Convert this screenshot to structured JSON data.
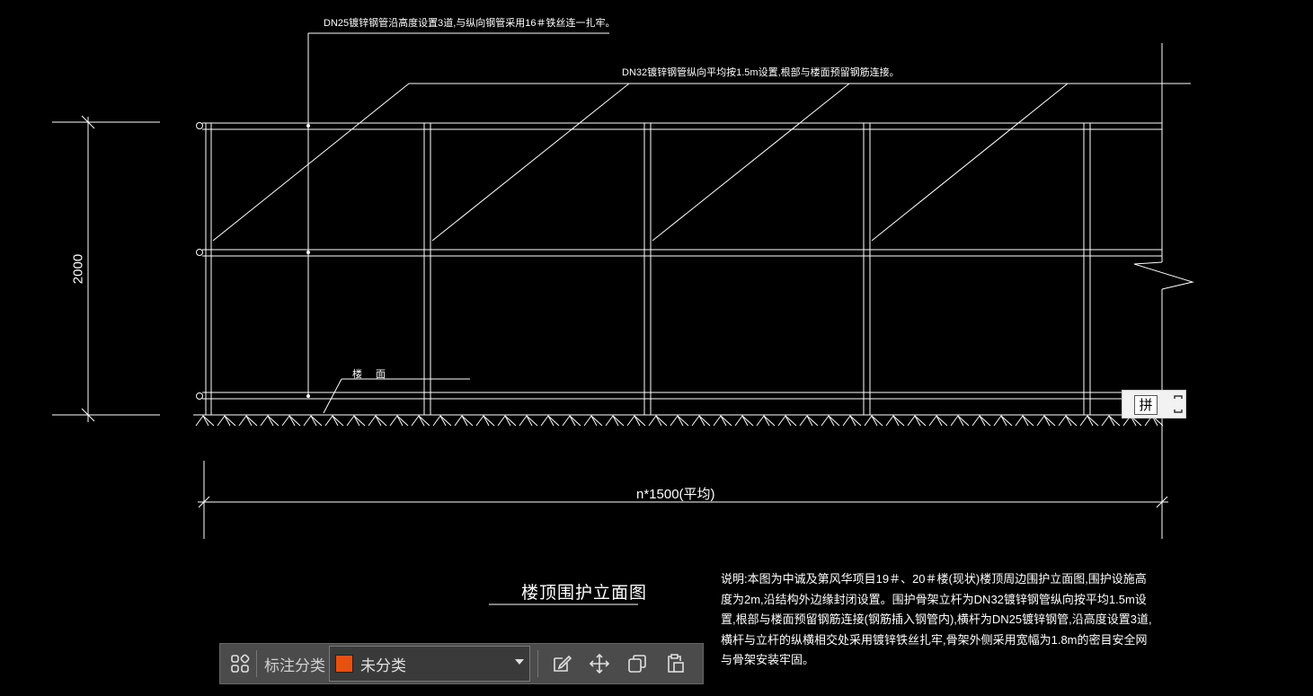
{
  "drawing": {
    "note_top": "DN25镀锌钢管沿高度设置3道,与纵向钢管采用16＃铁丝连一扎牢。",
    "note_mid": "DN32镀锌钢管纵向平均按1.5m设置,根部与楼面预留钢筋连接。",
    "label_floor": "楼 面",
    "dim_height": "2000",
    "dim_width": "n*1500(平均)",
    "title": "楼顶围护立面图",
    "description": "说明:本图为中诚及第风华项目19＃、20＃楼(现状)楼顶周边围护立面图,围护设施高度为2m,沿结构外边缘封闭设置。围护骨架立杆为DN32镀锌钢管纵向按平均1.5m设置,根部与楼面预留钢筋连接(钢筋插入钢管内),横杆为DN25镀锌钢管,沿高度设置3道,横杆与立杆的纵横相交处采用镀锌铁丝扎牢,骨架外侧采用宽幅为1.8m的密目安全网与骨架安装牢固。"
  },
  "pin_tool": {
    "char": "拼",
    "icon": "expand-corners-icon"
  },
  "toolbar": {
    "menu_icon": "four-grid-icon",
    "category_label": "标注分类",
    "category_value": "未分类",
    "category_color": "#e8500f",
    "actions": [
      "edit-icon",
      "move-icon",
      "copy-icon",
      "paste-icon"
    ]
  }
}
